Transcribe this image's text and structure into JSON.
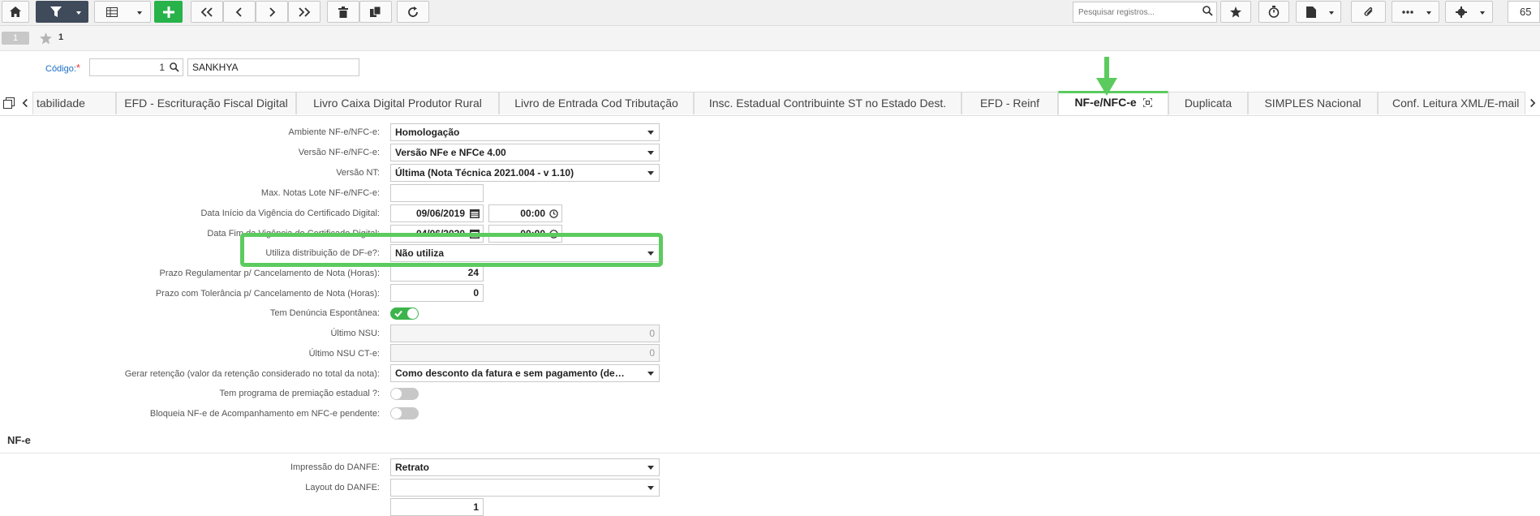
{
  "toolbar": {
    "search_placeholder": "Pesquisar registros...",
    "page_number": "65",
    "icons": [
      "home-icon",
      "filter-icon",
      "grid-icon",
      "plus-icon",
      "first-icon",
      "prev-icon",
      "next-icon",
      "last-icon",
      "trash-icon",
      "copy-icon",
      "refresh-icon",
      "search-icon",
      "star-icon",
      "stopwatch-icon",
      "report-icon",
      "attach-icon",
      "more-icon",
      "gear-icon"
    ]
  },
  "record_bar": {
    "badge": "1",
    "star_count": "1"
  },
  "header": {
    "codigo_label": "Código:",
    "required_mark": "*",
    "codigo_value": "1",
    "company_name": "SANKHYA"
  },
  "tabs": [
    "tabilidade",
    "EFD - Escrituração Fiscal Digital",
    "Livro Caixa Digital Produtor Rural",
    "Livro de Entrada Cod Tributação",
    "Insc. Estadual Contribuinte ST no Estado Dest.",
    "EFD - Reinf",
    "NF-e/NFC-e",
    "Duplicata",
    "SIMPLES Nacional",
    "Conf. Leitura XML/E-mail"
  ],
  "active_tab": "NF-e/NFC-e",
  "form": {
    "ambiente_label": "Ambiente NF-e/NFC-e:",
    "ambiente_value": "Homologação",
    "versao_label": "Versão NF-e/NFC-e:",
    "versao_value": "Versão NFe e NFCe 4.00",
    "versao_nt_label": "Versão NT:",
    "versao_nt_value": "Última (Nota Técnica 2021.004 - v 1.10)",
    "max_notas_label": "Max. Notas Lote NF-e/NFC-e:",
    "max_notas_value": "",
    "data_inicio_label": "Data Início da Vigência do Certificado Digital:",
    "data_inicio_date": "09/06/2019",
    "data_inicio_time": "00:00",
    "data_fim_label": "Data Fim da Vigência do Certificado Digital:",
    "data_fim_date": "04/06/2020",
    "data_fim_time": "00:00",
    "utiliza_label": "Utiliza distribuição de DF-e?:",
    "utiliza_value": "Não utiliza",
    "prazo_reg_label": "Prazo Regulamentar p/ Cancelamento de Nota (Horas):",
    "prazo_reg_value": "24",
    "prazo_tol_label": "Prazo com Tolerância p/ Cancelamento de Nota (Horas):",
    "prazo_tol_value": "0",
    "denuncia_label": "Tem Denúncia Espontânea:",
    "denuncia_on": true,
    "nsu_label": "Último NSU:",
    "nsu_value": "0",
    "nsu_cte_label": "Último NSU CT-e:",
    "nsu_cte_value": "0",
    "retencao_label": "Gerar retenção (valor da retenção considerado no total da nota):",
    "retencao_value": "Como desconto da fatura e sem pagamento (de…",
    "premiacao_label": "Tem programa de premiação estadual ?:",
    "premiacao_on": false,
    "bloqueia_label": "Bloqueia NF-e de Acompanhamento em NFC-e pendente:",
    "bloqueia_on": false
  },
  "nfe_section": {
    "title": "NF-e",
    "impressao_label": "Impressão do DANFE:",
    "impressao_value": "Retrato",
    "layout_label": "Layout do DANFE:",
    "layout_value": "",
    "numero_value": "1"
  },
  "colors": {
    "accent_green": "#5ccb5f",
    "toggle_on": "#3cb44b",
    "link_blue": "#1b6fc4",
    "toolbar_dark": "#3f4b5b"
  }
}
